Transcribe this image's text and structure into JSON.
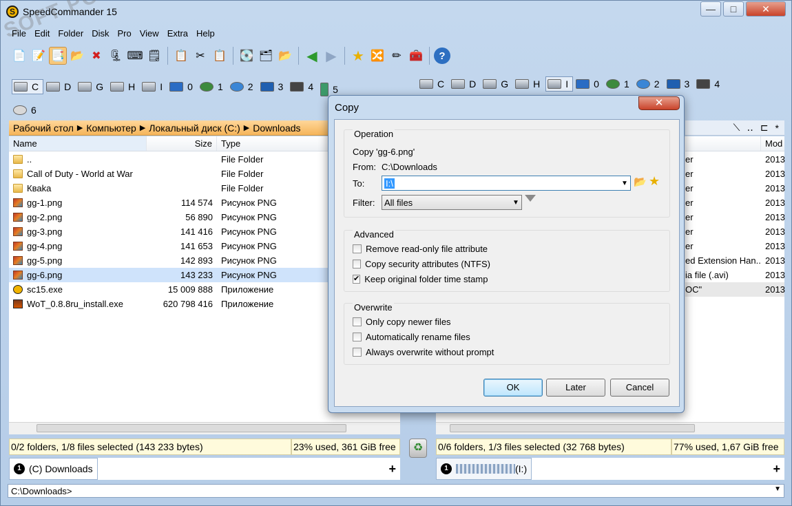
{
  "app": {
    "title": "SpeedCommander 15",
    "logo": "S"
  },
  "window_buttons": {
    "minimize": "—",
    "maximize": "□",
    "close": "✕"
  },
  "menu": [
    "File",
    "Edit",
    "Folder",
    "Disk",
    "Pro",
    "View",
    "Extra",
    "Help"
  ],
  "left_drives": [
    "C",
    "D",
    "G",
    "H",
    "I",
    "0",
    "1",
    "2",
    "3",
    "4",
    "5",
    "6"
  ],
  "right_drives": [
    "C",
    "D",
    "G",
    "H",
    "I",
    "0",
    "1",
    "2",
    "3",
    "4"
  ],
  "left": {
    "path": [
      "Рабочий стол",
      "Компьютер",
      "Локальный диск (C:)",
      "Downloads"
    ],
    "columns": {
      "name": "Name",
      "size": "Size",
      "type": "Type"
    },
    "files": [
      {
        "name": "..",
        "size": "",
        "type": "File Folder",
        "icon": "folder"
      },
      {
        "name": "Call of Duty - World at War",
        "size": "",
        "type": "File Folder",
        "icon": "folder"
      },
      {
        "name": "Кваkа",
        "size": "",
        "type": "File Folder",
        "icon": "folder"
      },
      {
        "name": "gg-1.png",
        "size": "114 574",
        "type": "Рисунок PNG",
        "icon": "png"
      },
      {
        "name": "gg-2.png",
        "size": "56 890",
        "type": "Рисунок PNG",
        "icon": "png"
      },
      {
        "name": "gg-3.png",
        "size": "141 416",
        "type": "Рисунок PNG",
        "icon": "png"
      },
      {
        "name": "gg-4.png",
        "size": "141 653",
        "type": "Рисунок PNG",
        "icon": "png"
      },
      {
        "name": "gg-5.png",
        "size": "142 893",
        "type": "Рисунок PNG",
        "icon": "png"
      },
      {
        "name": "gg-6.png",
        "size": "143 233",
        "type": "Рисунок PNG",
        "icon": "png"
      },
      {
        "name": "sc15.exe",
        "size": "15 009 888",
        "type": "Приложение",
        "icon": "exe"
      },
      {
        "name": "WoT_0.8.8ru_install.exe",
        "size": "620 798 416",
        "type": "Приложение",
        "icon": "exe2"
      }
    ],
    "status_sel": "0/2 folders, 1/8 files selected (143 233 bytes)",
    "status_free": "23% used, 361 GiB free",
    "tab": "(C) Downloads",
    "tab_num": "1"
  },
  "right": {
    "col_mod": "Mod",
    "rows": [
      {
        "type": "er",
        "date": "2013"
      },
      {
        "type": "er",
        "date": "2013"
      },
      {
        "type": "er",
        "date": "2013"
      },
      {
        "type": "er",
        "date": "2013"
      },
      {
        "type": "er",
        "date": "2013"
      },
      {
        "type": "er",
        "date": "2013"
      },
      {
        "type": "er",
        "date": "2013"
      },
      {
        "type": "ed Extension Han...",
        "date": "2013"
      },
      {
        "type": "ia file (.avi)",
        "date": "2013"
      },
      {
        "type": "OC\"",
        "date": "2013"
      }
    ],
    "status_sel": "0/6 folders, 1/3 files selected (32 768 bytes)",
    "status_free": "77% used, 1,67 GiB free",
    "tab": "(I:)",
    "tab_num": "1"
  },
  "cmdline": "C:\\Downloads>",
  "plus": "+",
  "dialog": {
    "title": "Copy",
    "close": "✕",
    "operation": {
      "title": "Operation",
      "copy_line": "Copy 'gg-6.png'",
      "from_label": "From:",
      "from_value": "C:\\Downloads",
      "to_label": "To:",
      "to_value": "I:\\",
      "filter_label": "Filter:",
      "filter_value": "All files"
    },
    "advanced": {
      "title": "Advanced",
      "options": [
        {
          "label": "Remove read-only file attribute",
          "checked": false
        },
        {
          "label": "Copy security attributes (NTFS)",
          "checked": false
        },
        {
          "label": "Keep original folder time stamp",
          "checked": true
        }
      ]
    },
    "overwrite": {
      "title": "Overwrite",
      "options": [
        {
          "label": "Only copy newer files",
          "checked": false
        },
        {
          "label": "Automatically rename files",
          "checked": false
        },
        {
          "label": "Always overwrite without prompt",
          "checked": false
        }
      ]
    },
    "buttons": {
      "ok": "OK",
      "later": "Later",
      "cancel": "Cancel"
    }
  },
  "watermark": "SOFT PORTAL"
}
